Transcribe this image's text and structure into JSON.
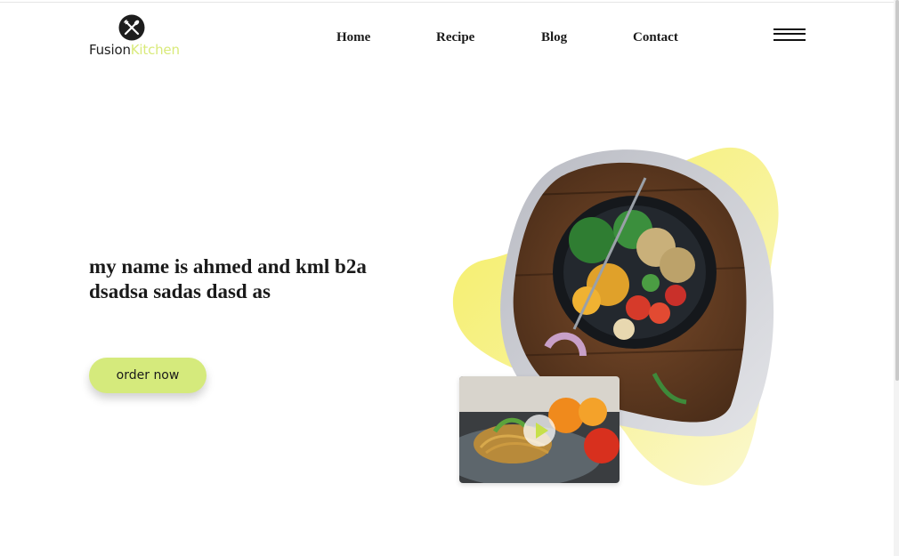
{
  "brand": {
    "name_part1": "Fusion",
    "name_part2": "Kitchen",
    "accent_color": "#d5ea7c",
    "logo_icon": "fork-knife-icon"
  },
  "nav": {
    "items": [
      {
        "label": "Home"
      },
      {
        "label": "Recipe"
      },
      {
        "label": "Blog"
      },
      {
        "label": "Contact"
      }
    ],
    "menu_icon": "hamburger-menu-icon"
  },
  "hero": {
    "headline": "my name is ahmed and kml b2a dsadsa sadas dasd as",
    "cta_label": "order now",
    "blob_color": "#f6f17a",
    "ring_color": "#c6c8ce",
    "video_icon": "play-icon"
  }
}
